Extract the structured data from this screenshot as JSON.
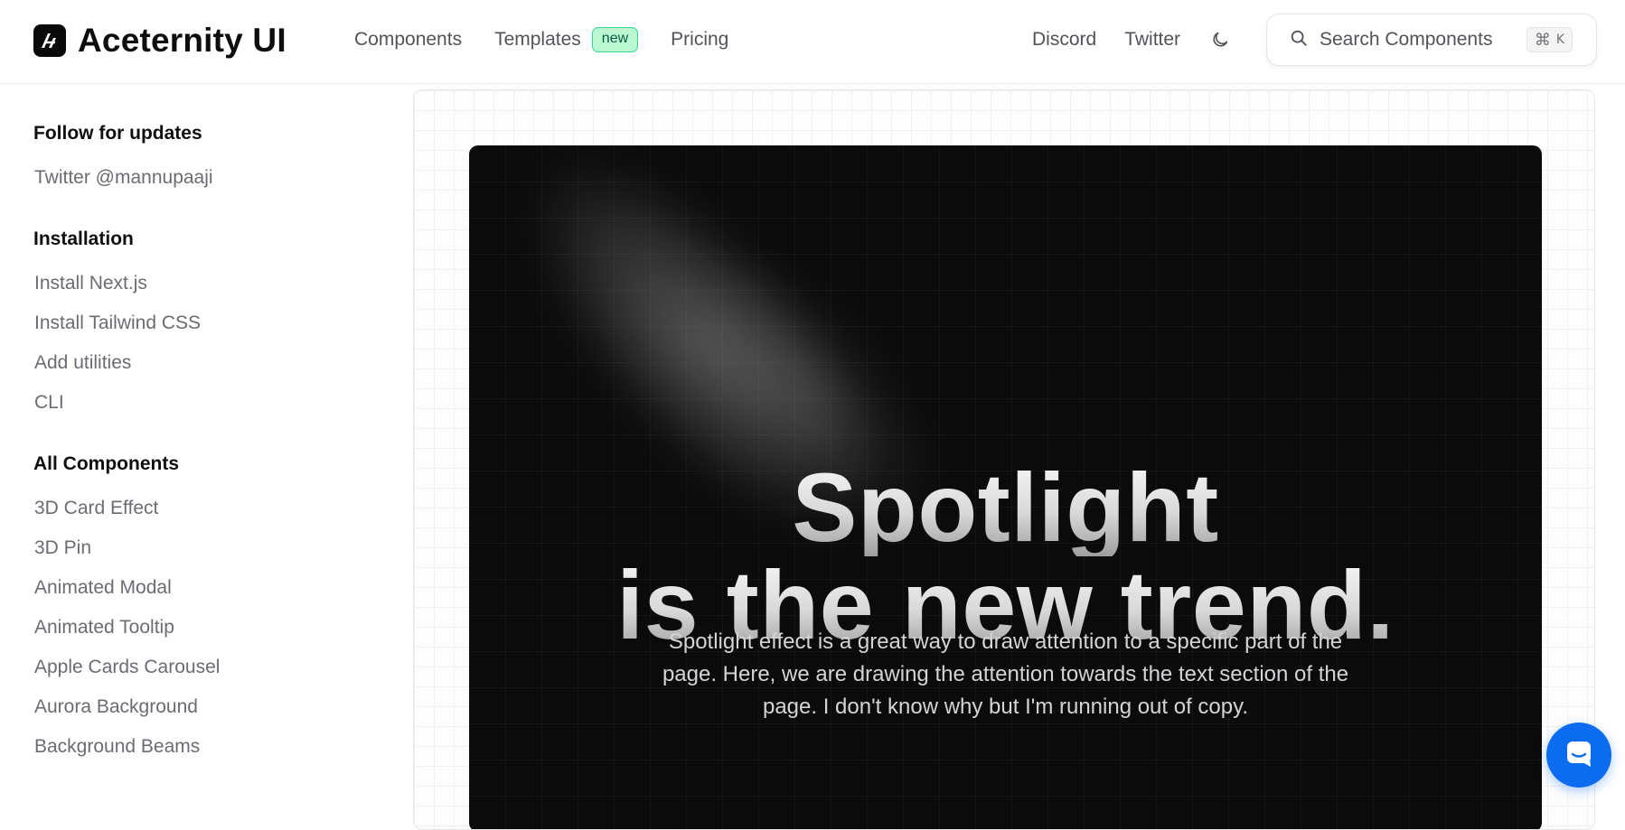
{
  "header": {
    "brand": "Aceternity UI",
    "nav": {
      "components": "Components",
      "templates": "Templates",
      "templates_badge": "new",
      "pricing": "Pricing",
      "discord": "Discord",
      "twitter": "Twitter"
    },
    "search": {
      "label": "Search Components",
      "shortcut_symbol": "⌘",
      "shortcut_key": "K"
    }
  },
  "sidebar": {
    "follow_title": "Follow for updates",
    "follow_link": "Twitter @mannupaaji",
    "installation_title": "Installation",
    "installation_items": [
      "Install Next.js",
      "Install Tailwind CSS",
      "Add utilities",
      "CLI"
    ],
    "components_title": "All Components",
    "components_items": [
      "3D Card Effect",
      "3D Pin",
      "Animated Modal",
      "Animated Tooltip",
      "Apple Cards Carousel",
      "Aurora Background",
      "Background Beams"
    ]
  },
  "preview": {
    "headline_line1": "Spotlight",
    "headline_line2": "is the new trend.",
    "description": "Spotlight effect is a great way to draw attention to a specific part of the page. Here, we are drawing the attention towards the text section of the page. I don't know why but I'm running out of copy."
  },
  "icons": {
    "logo": "aceternity-logo-icon",
    "theme": "moon-icon",
    "search": "search-icon",
    "chat": "chat-icon"
  },
  "colors": {
    "badge_bg": "#bbf7d0",
    "badge_border": "#34d399",
    "card_bg": "#0b0b0b",
    "chat_button": "#0b6cf0"
  }
}
